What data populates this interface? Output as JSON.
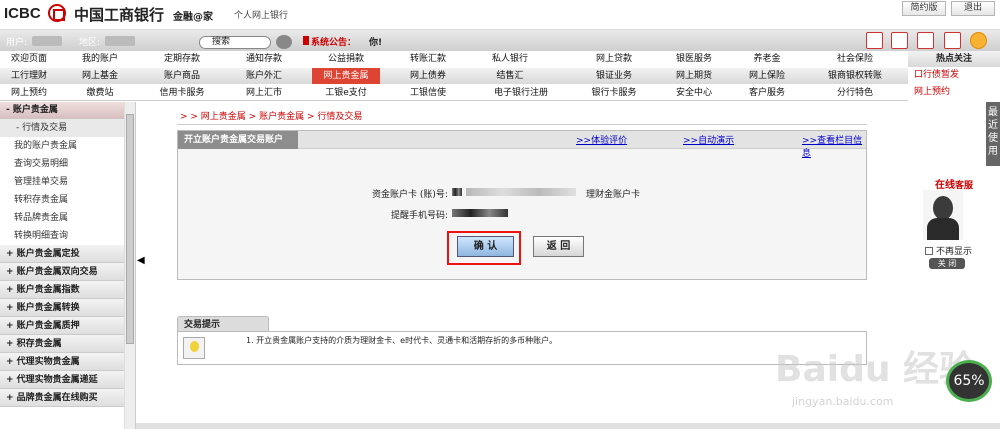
{
  "header": {
    "logo": "ICBC",
    "bank_name": "中国工商银行",
    "slogan": "金融@家",
    "personal": "个人网上银行",
    "simplified_btn": "简约版",
    "logout_btn": "退出"
  },
  "userbar": {
    "user_label": "用户:",
    "region_label": "地区:",
    "search_placeholder": "搜索",
    "announcement_label": "系统公告：",
    "announcement_text": "你!"
  },
  "nav": {
    "row1": [
      "欢迎页面",
      "我的账户",
      "定期存款",
      "通知存款",
      "公益捐款",
      "转账汇款",
      "私人银行",
      "网上贷款",
      "银医服务",
      "养老金",
      "社会保险"
    ],
    "row2": [
      "工行理财",
      "网上基金",
      "账户商品",
      "账户外汇",
      "网上贵金属",
      "网上债券",
      "结售汇",
      "银证业务",
      "网上期货",
      "网上保险",
      "银商银权转账"
    ],
    "row3": [
      "网上预约",
      "缴费站",
      "信用卡服务",
      "网上汇市",
      "工银e支付",
      "工银信使",
      "电子银行注册",
      "银行卡服务",
      "安全中心",
      "客户服务",
      "分行特色"
    ],
    "active": "网上贵金属"
  },
  "hot": {
    "title": "热点关注",
    "items": [
      "口行债暂发",
      "网上预约"
    ]
  },
  "sidebar": {
    "section": "- 账户贵金属",
    "items": [
      "- 行情及交易",
      "我的账户贵金属",
      "查询交易明细",
      "管理挂单交易",
      "转积存贵金属",
      "转品牌贵金属",
      "转换明细查询"
    ],
    "groups": [
      "+ 账户贵金属定投",
      "+ 账户贵金属双向交易",
      "+ 账户贵金属指数",
      "+ 账户贵金属转换",
      "+ 账户贵金属质押",
      "+ 积存贵金属",
      "+ 代理实物贵金属",
      "+ 代理实物贵金属递延",
      "+ 品牌贵金属在线购买"
    ]
  },
  "breadcrumb": "> > 网上贵金属 > 账户贵金属 > 行情及交易",
  "panel": {
    "title": "开立账户贵金属交易账户",
    "links": [
      ">>体验评价",
      ">>自动演示",
      ">>查看栏目信息"
    ],
    "account_label": "资金账户卡 (账)号:",
    "account_suffix": "理财金账户卡",
    "phone_label": "提醒手机号码:",
    "confirm_btn": "确 认",
    "back_btn": "返 回"
  },
  "tips": {
    "tab": "交易提示",
    "text": "1. 开立贵金属账户支持的介质为理财金卡、e时代卡、灵通卡和活期存折的多币种账户。"
  },
  "online": {
    "title_big": "在线",
    "title_small": "客服",
    "no_show": "不再显示",
    "close": "关 闭"
  },
  "right_tab": "最近使用",
  "gauge": "65%",
  "watermark": {
    "logo": "Baidu 经验",
    "url": "jingyan.baidu.com"
  },
  "colors": {
    "brand_red": "#cc0000",
    "link_blue": "#0000cc",
    "panel_head": "#8d8d8d"
  }
}
